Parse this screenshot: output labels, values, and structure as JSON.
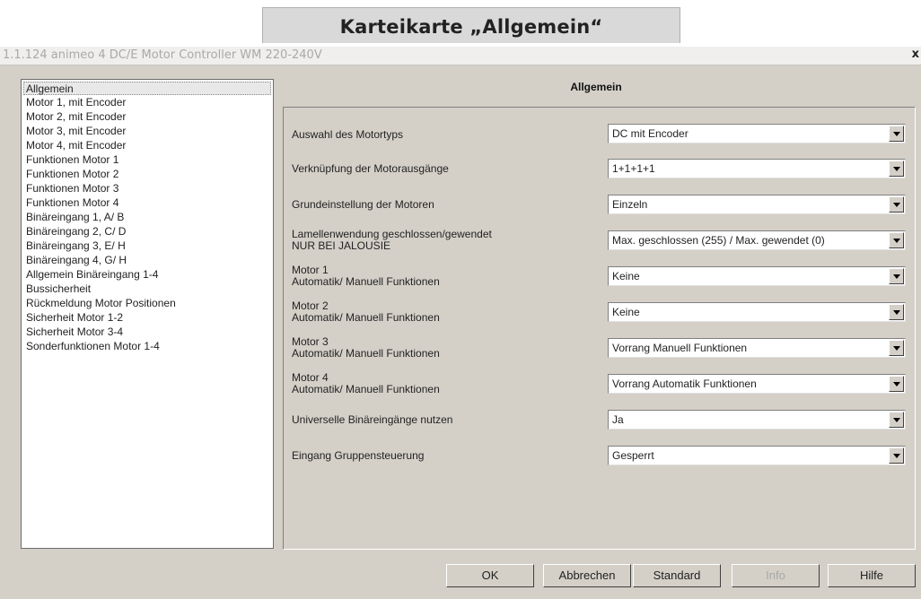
{
  "caption": "Karteikarte „Allgemein“",
  "window": {
    "title": "1.1.124 animeo 4 DC/E Motor Controller WM 220-240V",
    "close_label": "x"
  },
  "nav": {
    "items": [
      "Allgemein",
      "Motor 1, mit Encoder",
      "Motor 2, mit Encoder",
      "Motor 3, mit Encoder",
      "Motor 4, mit Encoder",
      "Funktionen Motor 1",
      "Funktionen Motor 2",
      "Funktionen Motor 3",
      "Funktionen Motor 4",
      "Binäreingang 1, A/ B",
      "Binäreingang 2, C/ D",
      "Binäreingang 3, E/ H",
      "Binäreingang 4, G/ H",
      "Allgemein Binäreingang 1-4",
      "Bussicherheit",
      "Rückmeldung Motor Positionen",
      "Sicherheit Motor 1-2",
      "Sicherheit Motor 3-4",
      "Sonderfunktionen Motor 1-4"
    ],
    "selected": "Allgemein"
  },
  "panel": {
    "title": "Allgemein",
    "params": [
      {
        "label1": "Auswahl des Motortyps",
        "label2": "",
        "value": "DC mit Encoder"
      },
      {
        "label1": "Verknüpfung der Motorausgänge",
        "label2": "",
        "value": "1+1+1+1"
      },
      {
        "label1": "Grundeinstellung der Motoren",
        "label2": "",
        "value": "Einzeln"
      },
      {
        "label1": "Lamellenwendung geschlossen/gewendet",
        "label2": "NUR BEI JALOUSIE",
        "value": "Max. geschlossen (255) / Max. gewendet (0)"
      },
      {
        "label1": "Motor 1",
        "label2": "Automatik/ Manuell Funktionen",
        "value": "Keine"
      },
      {
        "label1": "Motor 2",
        "label2": "Automatik/ Manuell Funktionen",
        "value": "Keine"
      },
      {
        "label1": "Motor 3",
        "label2": "Automatik/ Manuell Funktionen",
        "value": "Vorrang Manuell Funktionen"
      },
      {
        "label1": "Motor 4",
        "label2": "Automatik/ Manuell Funktionen",
        "value": "Vorrang Automatik Funktionen"
      },
      {
        "label1": "Universelle Binäreingänge nutzen",
        "label2": "",
        "value": "Ja"
      },
      {
        "label1": "Eingang Gruppensteuerung",
        "label2": "",
        "value": "Gesperrt"
      }
    ]
  },
  "buttons": {
    "ok": "OK",
    "cancel": "Abbrechen",
    "default": "Standard",
    "info": "Info",
    "help": "Hilfe"
  },
  "colors": {
    "dialog_bg": "#d4d0c8",
    "caption_bg": "#d9d9d9",
    "disabled_text": "#a8a8a8"
  }
}
